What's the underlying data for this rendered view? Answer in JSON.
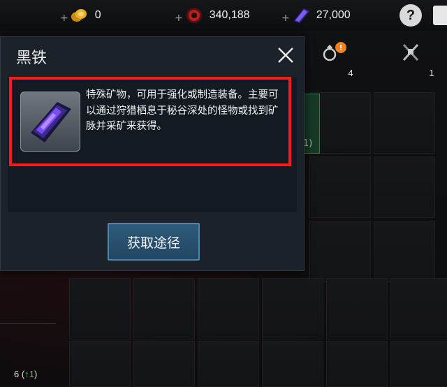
{
  "topbar": {
    "currencies": [
      {
        "icon": "gold-coins-icon",
        "value": "0",
        "color": "#e0a020"
      },
      {
        "icon": "red-gem-icon",
        "value": "340,188",
        "color": "#b02020"
      },
      {
        "icon": "blue-crystal-icon",
        "value": "27,000",
        "color": "#5a3fd0"
      }
    ],
    "plus_label": "+",
    "help_label": "?"
  },
  "tabs": [
    {
      "icon": "ring-icon",
      "count": "4",
      "badge": "!"
    },
    {
      "icon": "crossed-weapons-icon",
      "count": "1"
    }
  ],
  "modal": {
    "title": "黑铁",
    "description": "特殊矿物，可用于强化或制造装备。主要可以通过狩猎栖息于秘谷深处的怪物或找到矿脉并采矿来获得。",
    "item_icon": "black-iron-ore-icon",
    "acquire_label": "获取途径"
  },
  "background": {
    "partial_label": "1)",
    "bottom_count": "6",
    "bottom_up_open": "(",
    "bottom_up": "↑1",
    "bottom_up_close": ")"
  },
  "colors": {
    "highlight": "#ff1a1a",
    "button": "#2a5070",
    "modal_bg": "#1c2229"
  }
}
